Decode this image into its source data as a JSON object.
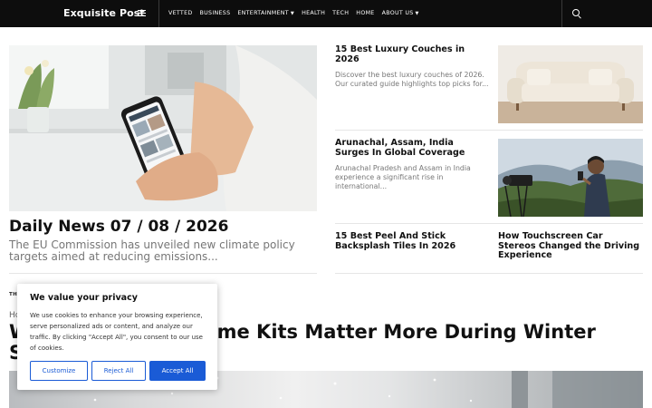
{
  "header": {
    "brand": "Exquisite Post",
    "nav": [
      {
        "label": "VETTED"
      },
      {
        "label": "BUSINESS"
      },
      {
        "label": "ENTERTAINMENT",
        "has_dropdown": true
      },
      {
        "label": "HEALTH"
      },
      {
        "label": "TECH"
      },
      {
        "label": "HOME"
      },
      {
        "label": "ABOUT US",
        "has_dropdown": true
      }
    ],
    "menu_icon": "hamburger-menu-icon",
    "search_icon": "search-icon"
  },
  "hero": {
    "title": "Daily News 07 / 08 / 2026",
    "excerpt": "The EU Commission has unveiled new climate policy targets aimed at reducing emissions..."
  },
  "side_cards": [
    {
      "title": "15 Best Luxury Couches in 2026",
      "excerpt": "Discover the best luxury couches of 2026. Our curated guide highlights top picks for..."
    },
    {
      "title": "Arunachal, Assam, India Surges In Global Coverage",
      "excerpt": "Arunachal Pradesh and Assam in India experience a significant rise in international..."
    },
    {
      "title": "15 Best Peel And Stick Backsplash Tiles In 2026",
      "excerpt": ""
    },
    {
      "title": "How Touchscreen Car Stereos Changed the Driving Experience",
      "excerpt": ""
    }
  ],
  "section": {
    "label": "THE",
    "breadcrumb": "Ho",
    "title": "Why Emergency Home Kits Matter More During Winter Storm Season"
  },
  "cookie": {
    "title": "We value your privacy",
    "text": "We use cookies to enhance your browsing experience, serve personalized ads or content, and analyze our traffic. By clicking \"Accept All\", you consent to our use of cookies.",
    "customize": "Customize",
    "reject": "Reject All",
    "accept": "Accept All"
  },
  "colors": {
    "topbar": "#0d0d0d",
    "accent": "#1a5bd6",
    "excerpt": "#777777"
  }
}
